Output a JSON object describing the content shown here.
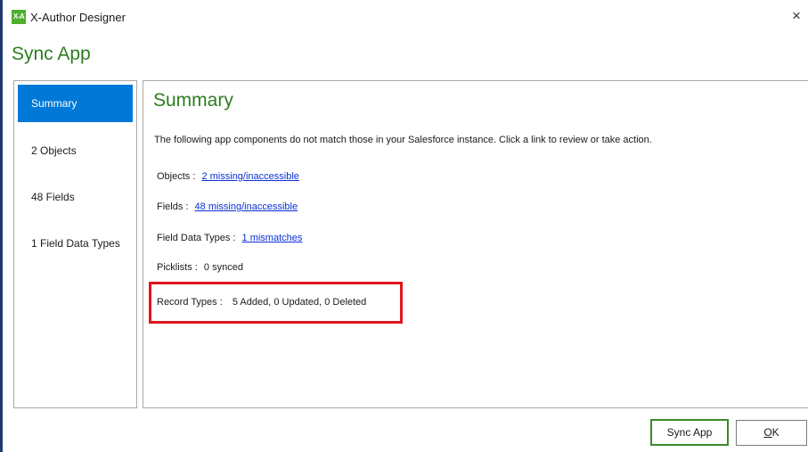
{
  "window": {
    "logo_text": "X-A",
    "title": "X-Author Designer",
    "close_glyph": "×"
  },
  "dialog": {
    "title": "Sync App"
  },
  "sidebar": {
    "items": [
      {
        "label": "Summary",
        "active": true
      },
      {
        "label": "2 Objects",
        "active": false
      },
      {
        "label": "48 Fields",
        "active": false
      },
      {
        "label": "1 Field Data Types",
        "active": false
      }
    ]
  },
  "summary": {
    "heading": "Summary",
    "description": "The following app components do not match those in your Salesforce instance. Click a link to review or take action.",
    "rows": {
      "objects": {
        "label": "Objects :",
        "link": "2 missing/inaccessible"
      },
      "fields": {
        "label": "Fields :",
        "link": "48 missing/inaccessible"
      },
      "field_data_types": {
        "label": "Field Data Types :",
        "link": "1 mismatches"
      },
      "picklists": {
        "label": "Picklists :",
        "value": "0 synced"
      },
      "record_types": {
        "label": "Record Types :",
        "value": "5 Added, 0 Updated, 0 Deleted"
      }
    }
  },
  "footer": {
    "sync_label": "Sync App",
    "ok_mnemonic": "O",
    "ok_rest": "K"
  },
  "colors": {
    "accent_green": "#2e7d1f",
    "selection_blue": "#0078d7",
    "link_blue": "#0a2fd6",
    "highlight_red": "#e0161d"
  }
}
